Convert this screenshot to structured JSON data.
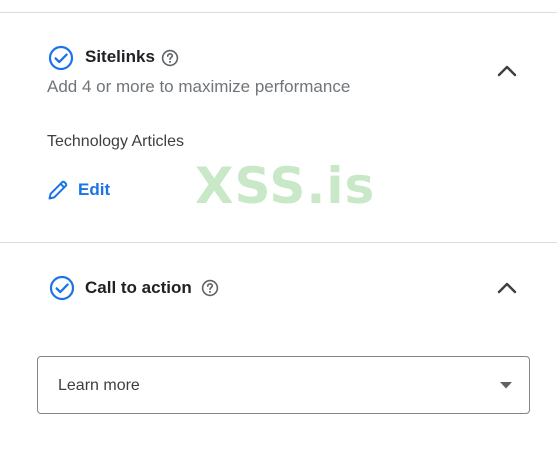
{
  "sitelinks": {
    "title": "Sitelinks",
    "subtitle": "Add 4 or more to maximize performance",
    "item": "Technology Articles",
    "edit_label": "Edit"
  },
  "call_to_action": {
    "title": "Call to action",
    "select_value": "Learn more"
  },
  "watermark": "XSS.is",
  "icons": {
    "status": "check-circle-icon",
    "help": "help-icon",
    "collapse": "chevron-up-icon",
    "edit": "pencil-icon",
    "dropdown": "caret-down-icon"
  },
  "colors": {
    "accent": "#1a73e8",
    "text": "#202124",
    "secondary_text": "#70757a",
    "divider": "#dadce0",
    "watermark": "#c8e8c8"
  }
}
